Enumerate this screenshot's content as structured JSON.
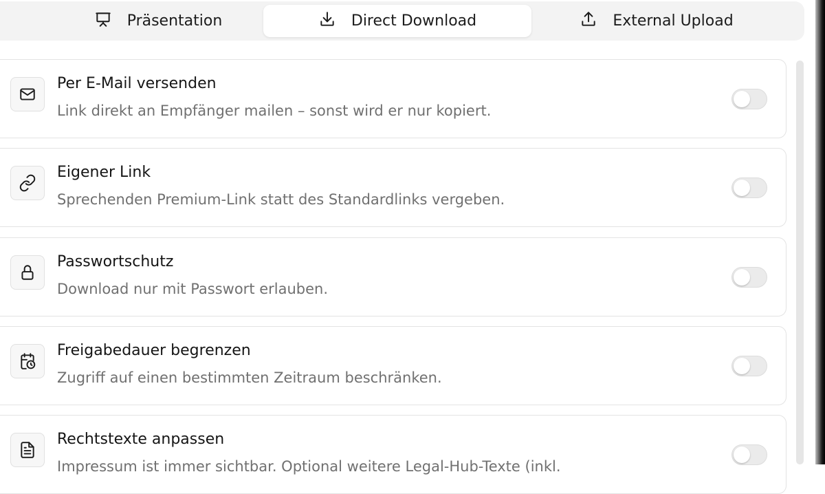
{
  "tabs": [
    {
      "label": "Präsentation",
      "icon": "presentation-icon",
      "active": false
    },
    {
      "label": "Direct Download",
      "icon": "download-icon",
      "active": true
    },
    {
      "label": "External Upload",
      "icon": "upload-icon",
      "active": false
    }
  ],
  "options": [
    {
      "title": "Per E-Mail versenden",
      "description": "Link direkt an Empfänger mailen – sonst wird er nur kopiert.",
      "icon": "mail-icon",
      "enabled": false
    },
    {
      "title": "Eigener Link",
      "description": "Sprechenden Premium-Link statt des Standardlinks vergeben.",
      "icon": "link-icon",
      "enabled": false
    },
    {
      "title": "Passwortschutz",
      "description": "Download nur mit Passwort erlauben.",
      "icon": "lock-icon",
      "enabled": false
    },
    {
      "title": "Freigabedauer begrenzen",
      "description": "Zugriff auf einen bestimmten Zeitraum beschränken.",
      "icon": "calendar-clock-icon",
      "enabled": false
    },
    {
      "title": "Rechtstexte anpassen",
      "description": "Impressum ist immer sichtbar. Optional weitere Legal-Hub-Texte (inkl.",
      "icon": "document-icon",
      "enabled": false
    }
  ],
  "colors": {
    "tabbar_bg": "#f3f3f3",
    "card_border": "#e3e3e3",
    "toggle_off": "#ebebeb",
    "description_text": "#707070"
  }
}
